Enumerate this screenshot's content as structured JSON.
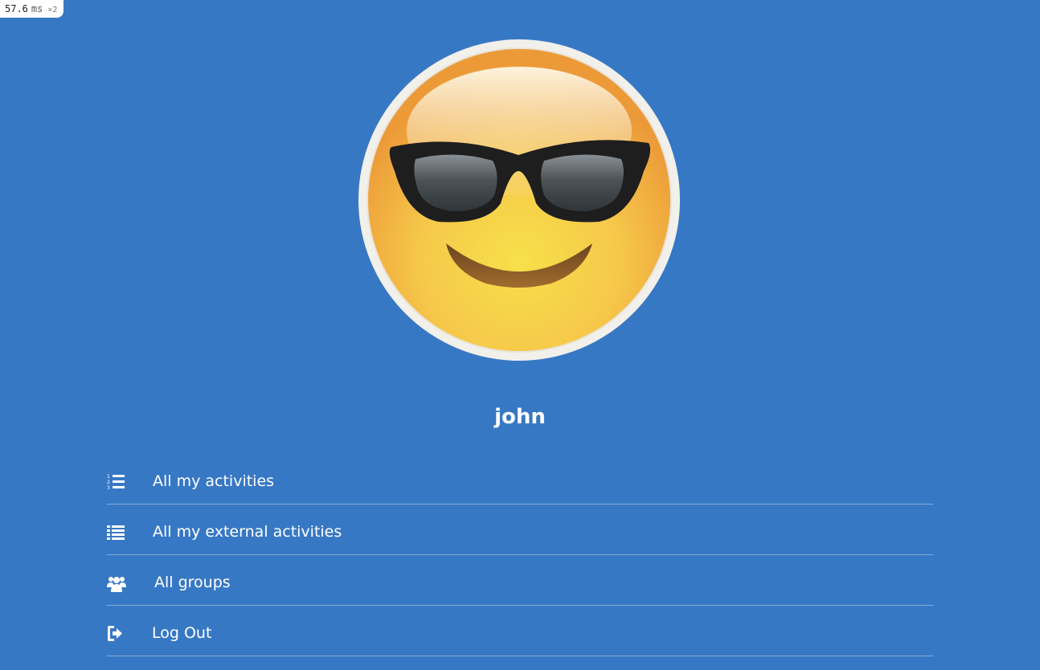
{
  "perf_badge": {
    "value": "57.6",
    "unit": "ms",
    "multiplier": "×2"
  },
  "profile": {
    "avatar_icon": "sunglasses-emoji-icon",
    "username": "john"
  },
  "menu": {
    "items": [
      {
        "label": "All my activities",
        "icon": "ordered-list-icon"
      },
      {
        "label": "All my external activities",
        "icon": "list-icon"
      },
      {
        "label": "All groups",
        "icon": "users-icon"
      },
      {
        "label": "Log Out",
        "icon": "sign-out-icon"
      }
    ]
  },
  "colors": {
    "background": "#3778c4",
    "text": "#ffffff",
    "divider": "rgba(255,255,255,0.38)"
  }
}
